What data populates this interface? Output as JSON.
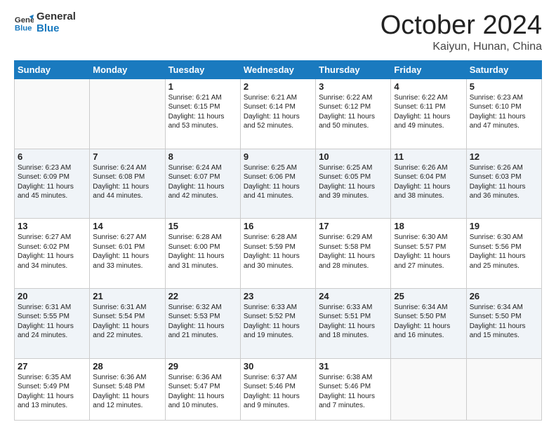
{
  "logo": {
    "line1": "General",
    "line2": "Blue"
  },
  "header": {
    "month": "October 2024",
    "location": "Kaiyun, Hunan, China"
  },
  "weekdays": [
    "Sunday",
    "Monday",
    "Tuesday",
    "Wednesday",
    "Thursday",
    "Friday",
    "Saturday"
  ],
  "weeks": [
    [
      {
        "day": "",
        "info": ""
      },
      {
        "day": "",
        "info": ""
      },
      {
        "day": "1",
        "info": "Sunrise: 6:21 AM\nSunset: 6:15 PM\nDaylight: 11 hours and 53 minutes."
      },
      {
        "day": "2",
        "info": "Sunrise: 6:21 AM\nSunset: 6:14 PM\nDaylight: 11 hours and 52 minutes."
      },
      {
        "day": "3",
        "info": "Sunrise: 6:22 AM\nSunset: 6:12 PM\nDaylight: 11 hours and 50 minutes."
      },
      {
        "day": "4",
        "info": "Sunrise: 6:22 AM\nSunset: 6:11 PM\nDaylight: 11 hours and 49 minutes."
      },
      {
        "day": "5",
        "info": "Sunrise: 6:23 AM\nSunset: 6:10 PM\nDaylight: 11 hours and 47 minutes."
      }
    ],
    [
      {
        "day": "6",
        "info": "Sunrise: 6:23 AM\nSunset: 6:09 PM\nDaylight: 11 hours and 45 minutes."
      },
      {
        "day": "7",
        "info": "Sunrise: 6:24 AM\nSunset: 6:08 PM\nDaylight: 11 hours and 44 minutes."
      },
      {
        "day": "8",
        "info": "Sunrise: 6:24 AM\nSunset: 6:07 PM\nDaylight: 11 hours and 42 minutes."
      },
      {
        "day": "9",
        "info": "Sunrise: 6:25 AM\nSunset: 6:06 PM\nDaylight: 11 hours and 41 minutes."
      },
      {
        "day": "10",
        "info": "Sunrise: 6:25 AM\nSunset: 6:05 PM\nDaylight: 11 hours and 39 minutes."
      },
      {
        "day": "11",
        "info": "Sunrise: 6:26 AM\nSunset: 6:04 PM\nDaylight: 11 hours and 38 minutes."
      },
      {
        "day": "12",
        "info": "Sunrise: 6:26 AM\nSunset: 6:03 PM\nDaylight: 11 hours and 36 minutes."
      }
    ],
    [
      {
        "day": "13",
        "info": "Sunrise: 6:27 AM\nSunset: 6:02 PM\nDaylight: 11 hours and 34 minutes."
      },
      {
        "day": "14",
        "info": "Sunrise: 6:27 AM\nSunset: 6:01 PM\nDaylight: 11 hours and 33 minutes."
      },
      {
        "day": "15",
        "info": "Sunrise: 6:28 AM\nSunset: 6:00 PM\nDaylight: 11 hours and 31 minutes."
      },
      {
        "day": "16",
        "info": "Sunrise: 6:28 AM\nSunset: 5:59 PM\nDaylight: 11 hours and 30 minutes."
      },
      {
        "day": "17",
        "info": "Sunrise: 6:29 AM\nSunset: 5:58 PM\nDaylight: 11 hours and 28 minutes."
      },
      {
        "day": "18",
        "info": "Sunrise: 6:30 AM\nSunset: 5:57 PM\nDaylight: 11 hours and 27 minutes."
      },
      {
        "day": "19",
        "info": "Sunrise: 6:30 AM\nSunset: 5:56 PM\nDaylight: 11 hours and 25 minutes."
      }
    ],
    [
      {
        "day": "20",
        "info": "Sunrise: 6:31 AM\nSunset: 5:55 PM\nDaylight: 11 hours and 24 minutes."
      },
      {
        "day": "21",
        "info": "Sunrise: 6:31 AM\nSunset: 5:54 PM\nDaylight: 11 hours and 22 minutes."
      },
      {
        "day": "22",
        "info": "Sunrise: 6:32 AM\nSunset: 5:53 PM\nDaylight: 11 hours and 21 minutes."
      },
      {
        "day": "23",
        "info": "Sunrise: 6:33 AM\nSunset: 5:52 PM\nDaylight: 11 hours and 19 minutes."
      },
      {
        "day": "24",
        "info": "Sunrise: 6:33 AM\nSunset: 5:51 PM\nDaylight: 11 hours and 18 minutes."
      },
      {
        "day": "25",
        "info": "Sunrise: 6:34 AM\nSunset: 5:50 PM\nDaylight: 11 hours and 16 minutes."
      },
      {
        "day": "26",
        "info": "Sunrise: 6:34 AM\nSunset: 5:50 PM\nDaylight: 11 hours and 15 minutes."
      }
    ],
    [
      {
        "day": "27",
        "info": "Sunrise: 6:35 AM\nSunset: 5:49 PM\nDaylight: 11 hours and 13 minutes."
      },
      {
        "day": "28",
        "info": "Sunrise: 6:36 AM\nSunset: 5:48 PM\nDaylight: 11 hours and 12 minutes."
      },
      {
        "day": "29",
        "info": "Sunrise: 6:36 AM\nSunset: 5:47 PM\nDaylight: 11 hours and 10 minutes."
      },
      {
        "day": "30",
        "info": "Sunrise: 6:37 AM\nSunset: 5:46 PM\nDaylight: 11 hours and 9 minutes."
      },
      {
        "day": "31",
        "info": "Sunrise: 6:38 AM\nSunset: 5:46 PM\nDaylight: 11 hours and 7 minutes."
      },
      {
        "day": "",
        "info": ""
      },
      {
        "day": "",
        "info": ""
      }
    ]
  ]
}
